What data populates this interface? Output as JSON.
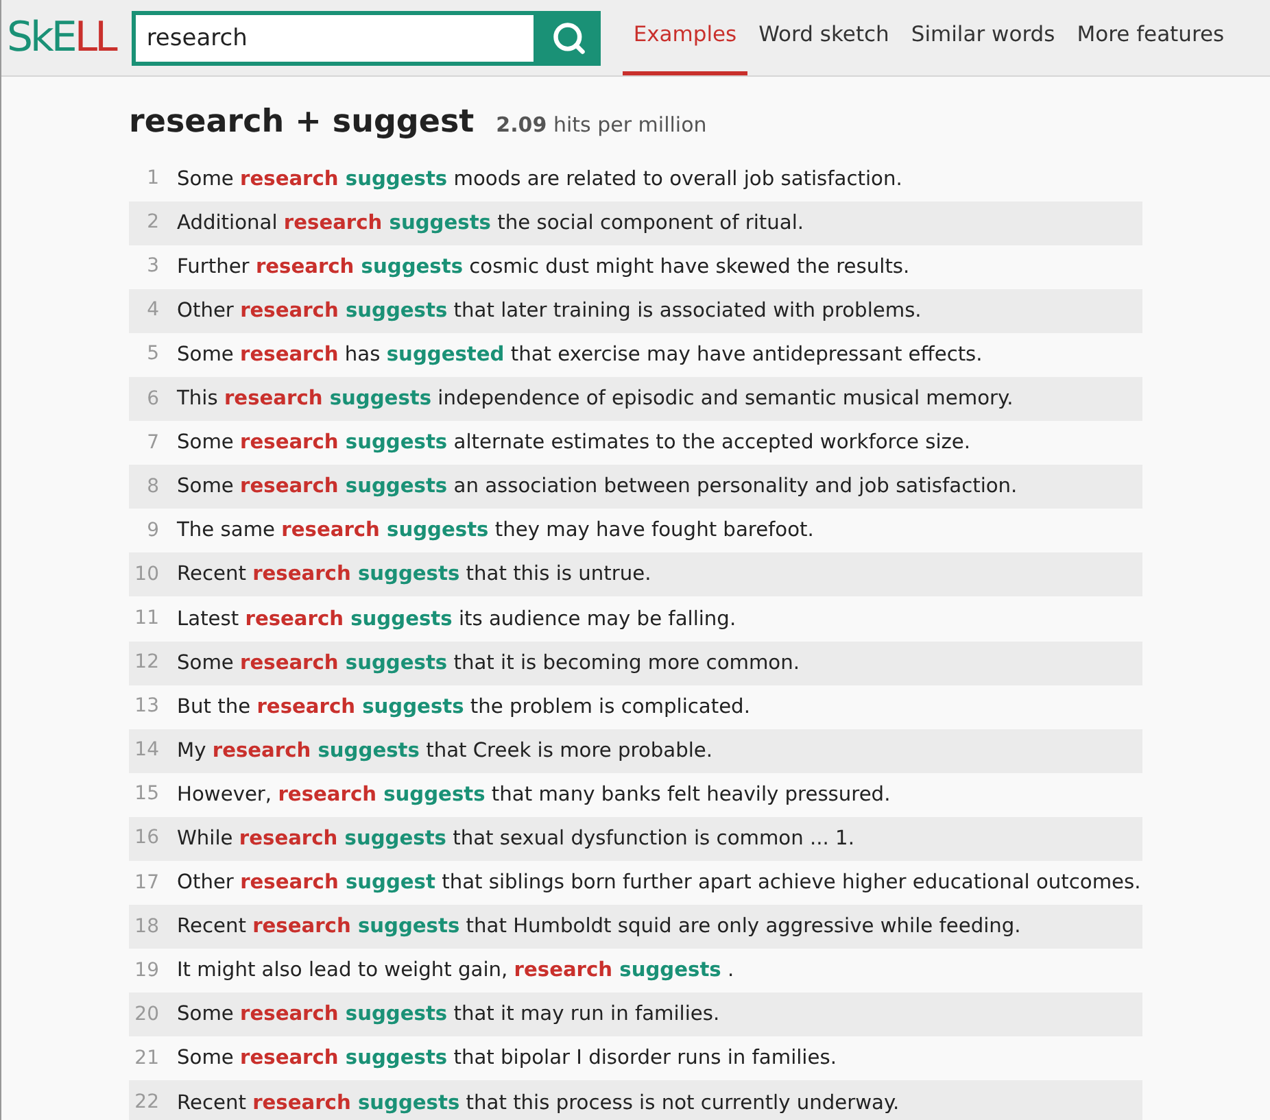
{
  "logo": {
    "parts": [
      {
        "text": "SkE",
        "kind": "plain"
      },
      {
        "text": "LL",
        "kind": "accent"
      }
    ]
  },
  "search": {
    "value": "research"
  },
  "tabs": [
    {
      "label": "Examples",
      "selected": true
    },
    {
      "label": "Word sketch",
      "selected": false
    },
    {
      "label": "Similar words",
      "selected": false
    },
    {
      "label": "More features",
      "selected": false
    }
  ],
  "heading": {
    "title": "research + suggest",
    "count": "2.09",
    "unit": "hits per million"
  },
  "rows": [
    {
      "number": "1",
      "parts": [
        {
          "text": "Some ",
          "kind": "plain"
        },
        {
          "text": "research ",
          "kind": "node"
        },
        {
          "text": "suggests",
          "kind": "collocate"
        },
        {
          "text": " moods are related to overall job satisfaction.",
          "kind": "plain"
        }
      ]
    },
    {
      "number": "2",
      "parts": [
        {
          "text": "Additional ",
          "kind": "plain"
        },
        {
          "text": "research ",
          "kind": "node"
        },
        {
          "text": "suggests",
          "kind": "collocate"
        },
        {
          "text": " the social component of ritual.",
          "kind": "plain"
        }
      ]
    },
    {
      "number": "3",
      "parts": [
        {
          "text": "Further ",
          "kind": "plain"
        },
        {
          "text": "research ",
          "kind": "node"
        },
        {
          "text": "suggests",
          "kind": "collocate"
        },
        {
          "text": " cosmic dust might have skewed the results.",
          "kind": "plain"
        }
      ]
    },
    {
      "number": "4",
      "parts": [
        {
          "text": "Other ",
          "kind": "plain"
        },
        {
          "text": "research ",
          "kind": "node"
        },
        {
          "text": "suggests",
          "kind": "collocate"
        },
        {
          "text": " that later training is associated with problems.",
          "kind": "plain"
        }
      ]
    },
    {
      "number": "5",
      "parts": [
        {
          "text": "Some ",
          "kind": "plain"
        },
        {
          "text": "research",
          "kind": "node"
        },
        {
          "text": " has ",
          "kind": "plain"
        },
        {
          "text": "suggested",
          "kind": "collocate"
        },
        {
          "text": " that exercise may have antidepressant effects.",
          "kind": "plain"
        }
      ]
    },
    {
      "number": "6",
      "parts": [
        {
          "text": "This ",
          "kind": "plain"
        },
        {
          "text": "research ",
          "kind": "node"
        },
        {
          "text": "suggests",
          "kind": "collocate"
        },
        {
          "text": " independence of episodic and semantic musical memory.",
          "kind": "plain"
        }
      ]
    },
    {
      "number": "7",
      "parts": [
        {
          "text": "Some ",
          "kind": "plain"
        },
        {
          "text": "research ",
          "kind": "node"
        },
        {
          "text": "suggests",
          "kind": "collocate"
        },
        {
          "text": " alternate estimates to the accepted workforce size.",
          "kind": "plain"
        }
      ]
    },
    {
      "number": "8",
      "parts": [
        {
          "text": "Some ",
          "kind": "plain"
        },
        {
          "text": "research ",
          "kind": "node"
        },
        {
          "text": "suggests",
          "kind": "collocate"
        },
        {
          "text": " an association between personality and job satisfaction.",
          "kind": "plain"
        }
      ]
    },
    {
      "number": "9",
      "parts": [
        {
          "text": "The same ",
          "kind": "plain"
        },
        {
          "text": "research ",
          "kind": "node"
        },
        {
          "text": "suggests",
          "kind": "collocate"
        },
        {
          "text": " they may have fought barefoot.",
          "kind": "plain"
        }
      ]
    },
    {
      "number": "10",
      "parts": [
        {
          "text": "Recent ",
          "kind": "plain"
        },
        {
          "text": "research ",
          "kind": "node"
        },
        {
          "text": "suggests",
          "kind": "collocate"
        },
        {
          "text": " that this is untrue.",
          "kind": "plain"
        }
      ]
    },
    {
      "number": "11",
      "parts": [
        {
          "text": "Latest ",
          "kind": "plain"
        },
        {
          "text": "research ",
          "kind": "node"
        },
        {
          "text": "suggests",
          "kind": "collocate"
        },
        {
          "text": " its audience may be falling.",
          "kind": "plain"
        }
      ]
    },
    {
      "number": "12",
      "parts": [
        {
          "text": "Some ",
          "kind": "plain"
        },
        {
          "text": "research ",
          "kind": "node"
        },
        {
          "text": "suggests",
          "kind": "collocate"
        },
        {
          "text": " that it is becoming more common.",
          "kind": "plain"
        }
      ]
    },
    {
      "number": "13",
      "parts": [
        {
          "text": "But the ",
          "kind": "plain"
        },
        {
          "text": "research ",
          "kind": "node"
        },
        {
          "text": "suggests",
          "kind": "collocate"
        },
        {
          "text": " the problem is complicated.",
          "kind": "plain"
        }
      ]
    },
    {
      "number": "14",
      "parts": [
        {
          "text": "My ",
          "kind": "plain"
        },
        {
          "text": "research ",
          "kind": "node"
        },
        {
          "text": "suggests",
          "kind": "collocate"
        },
        {
          "text": " that Creek is more probable.",
          "kind": "plain"
        }
      ]
    },
    {
      "number": "15",
      "parts": [
        {
          "text": "However, ",
          "kind": "plain"
        },
        {
          "text": "research ",
          "kind": "node"
        },
        {
          "text": "suggests",
          "kind": "collocate"
        },
        {
          "text": " that many banks felt heavily pressured.",
          "kind": "plain"
        }
      ]
    },
    {
      "number": "16",
      "parts": [
        {
          "text": "While ",
          "kind": "plain"
        },
        {
          "text": "research ",
          "kind": "node"
        },
        {
          "text": "suggests",
          "kind": "collocate"
        },
        {
          "text": " that sexual dysfunction is common ... 1.",
          "kind": "plain"
        }
      ]
    },
    {
      "number": "17",
      "parts": [
        {
          "text": "Other ",
          "kind": "plain"
        },
        {
          "text": "research ",
          "kind": "node"
        },
        {
          "text": "suggest",
          "kind": "collocate"
        },
        {
          "text": " that siblings born further apart achieve higher educational outcomes.",
          "kind": "plain"
        }
      ]
    },
    {
      "number": "18",
      "parts": [
        {
          "text": "Recent ",
          "kind": "plain"
        },
        {
          "text": "research ",
          "kind": "node"
        },
        {
          "text": "suggests",
          "kind": "collocate"
        },
        {
          "text": " that Humboldt squid are only aggressive while feeding.",
          "kind": "plain"
        }
      ]
    },
    {
      "number": "19",
      "parts": [
        {
          "text": "It might also lead to weight gain, ",
          "kind": "plain"
        },
        {
          "text": "research ",
          "kind": "node"
        },
        {
          "text": "suggests",
          "kind": "collocate"
        },
        {
          "text": " .",
          "kind": "plain"
        }
      ]
    },
    {
      "number": "20",
      "parts": [
        {
          "text": "Some ",
          "kind": "plain"
        },
        {
          "text": "research ",
          "kind": "node"
        },
        {
          "text": "suggests",
          "kind": "collocate"
        },
        {
          "text": " that it may run in families.",
          "kind": "plain"
        }
      ]
    },
    {
      "number": "21",
      "parts": [
        {
          "text": "Some ",
          "kind": "plain"
        },
        {
          "text": "research ",
          "kind": "node"
        },
        {
          "text": "suggests",
          "kind": "collocate"
        },
        {
          "text": " that bipolar I disorder runs in families.",
          "kind": "plain"
        }
      ]
    },
    {
      "number": "22",
      "parts": [
        {
          "text": "Recent ",
          "kind": "plain"
        },
        {
          "text": "research ",
          "kind": "node"
        },
        {
          "text": "suggests",
          "kind": "collocate"
        },
        {
          "text": " that this process is not currently underway.",
          "kind": "plain"
        }
      ]
    }
  ]
}
